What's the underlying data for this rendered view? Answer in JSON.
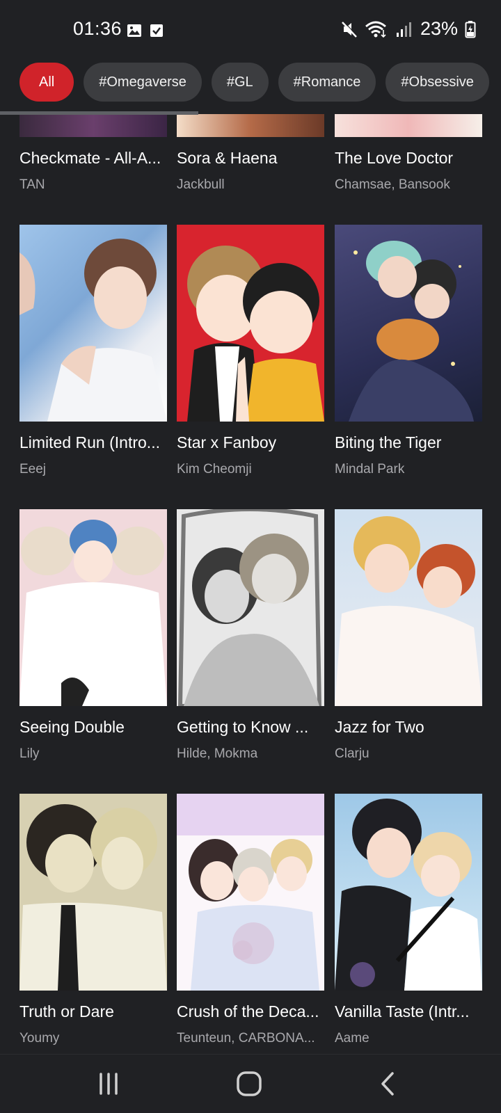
{
  "status_bar": {
    "time": "01:36",
    "battery": "23%",
    "icons": [
      "image-icon",
      "checkbox-icon",
      "mute-icon",
      "wifi-icon",
      "signal-icon",
      "battery-icon"
    ]
  },
  "filters": {
    "chips": [
      "All",
      "#Omegaverse",
      "#GL",
      "#Romance",
      "#Obsessive"
    ],
    "selected": "All",
    "colors": {
      "active": "#d0232a",
      "inactive": "#3c3d40"
    }
  },
  "comics": [
    {
      "title": "Checkmate - All-A...",
      "author": "TAN"
    },
    {
      "title": "Sora & Haena",
      "author": "Jackbull"
    },
    {
      "title": "The Love Doctor",
      "author": "Chamsae, Bansook"
    },
    {
      "title": "Limited Run (Intro...",
      "author": "Eeej"
    },
    {
      "title": "Star x Fanboy",
      "author": "Kim Cheomji"
    },
    {
      "title": "Biting the Tiger",
      "author": "Mindal Park"
    },
    {
      "title": "Seeing Double",
      "author": "Lily"
    },
    {
      "title": "Getting to Know ...",
      "author": "Hilde, Mokma"
    },
    {
      "title": "Jazz for Two",
      "author": "Clarju"
    },
    {
      "title": "Truth or Dare",
      "author": "Youmy"
    },
    {
      "title": "Crush of the Deca...",
      "author": "Teunteun, CARBONA..."
    },
    {
      "title": "Vanilla Taste (Intr...",
      "author": "Aame"
    }
  ],
  "nav_bar": {
    "buttons": [
      "recent-apps-icon",
      "home-icon",
      "back-icon"
    ]
  }
}
